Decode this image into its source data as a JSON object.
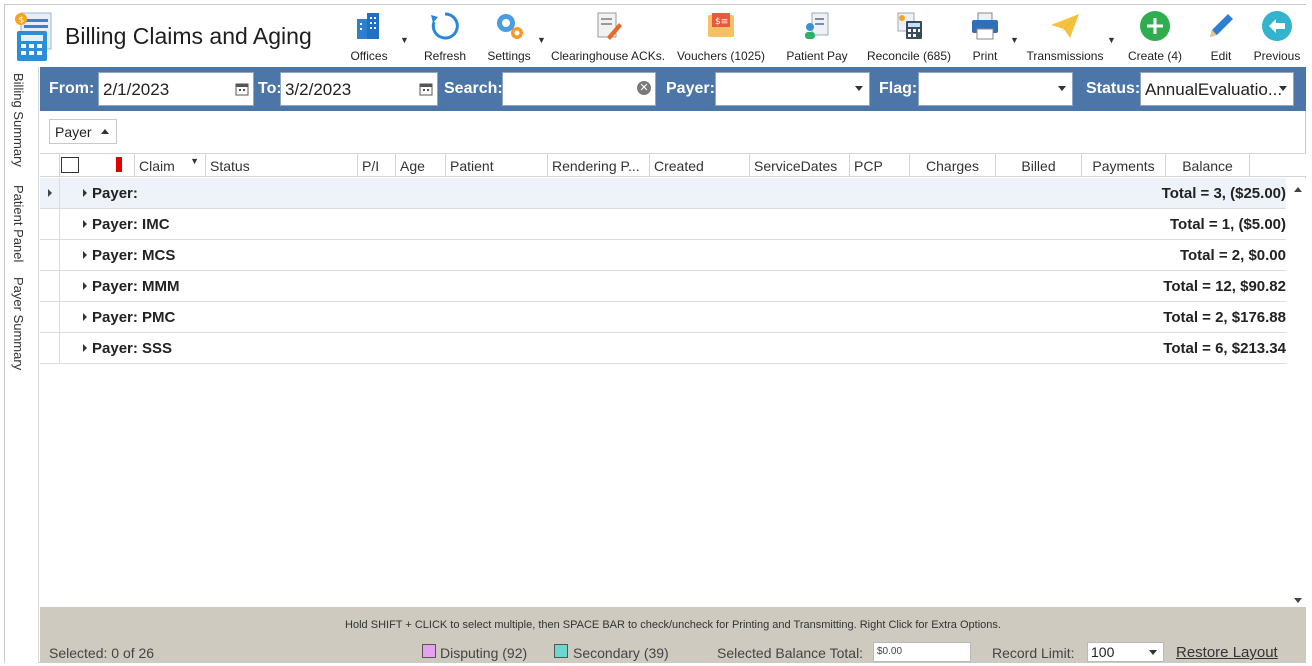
{
  "app": {
    "title": "Billing Claims and Aging"
  },
  "toolbar": {
    "items": [
      {
        "label": "Offices",
        "icon": "buildings-icon",
        "has_dropdown": true
      },
      {
        "label": "Refresh",
        "icon": "refresh-icon",
        "has_dropdown": false
      },
      {
        "label": "Settings",
        "icon": "gear-icon",
        "has_dropdown": true
      },
      {
        "label": "Clearinghouse ACKs.",
        "icon": "document-edit-icon",
        "has_dropdown": false
      },
      {
        "label": "Vouchers (1025)",
        "icon": "voucher-envelope-icon",
        "has_dropdown": false
      },
      {
        "label": "Patient Pay",
        "icon": "patient-receipt-icon",
        "has_dropdown": false
      },
      {
        "label": "Reconcile (685)",
        "icon": "calculator-icon",
        "has_dropdown": false
      },
      {
        "label": "Print",
        "icon": "printer-icon",
        "has_dropdown": true
      },
      {
        "label": "Transmissions",
        "icon": "paper-plane-icon",
        "has_dropdown": true
      },
      {
        "label": "Create (4)",
        "icon": "plus-circle-icon",
        "has_dropdown": false
      },
      {
        "label": "Edit",
        "icon": "pencil-icon",
        "has_dropdown": false
      },
      {
        "label": "Previous",
        "icon": "arrow-left-circle-icon",
        "has_dropdown": false
      }
    ]
  },
  "rail": {
    "tabs": [
      "Billing Summary",
      "Patient Panel",
      "Payer Summary"
    ]
  },
  "filters": {
    "from_label": "From:",
    "from_value": "2/1/2023",
    "to_label": "To:",
    "to_value": "3/2/2023",
    "search_label": "Search:",
    "search_value": "",
    "payer_label": "Payer:",
    "payer_value": "",
    "flag_label": "Flag:",
    "flag_value": "",
    "status_label": "Status:",
    "status_value": "AnnualEvaluatio..."
  },
  "group_by": {
    "label": "Payer"
  },
  "grid": {
    "columns": [
      "Claim",
      "Status",
      "P/I",
      "Age",
      "Patient",
      "Rendering P...",
      "Created",
      "ServiceDates",
      "PCP",
      "Charges",
      "Billed",
      "Payments",
      "Balance"
    ],
    "groups": [
      {
        "label": "Payer:",
        "total": "Total = 3,  ($25.00)"
      },
      {
        "label": "Payer: IMC",
        "total": "Total = 1,  ($5.00)"
      },
      {
        "label": "Payer: MCS",
        "total": "Total = 2,  $0.00"
      },
      {
        "label": "Payer: MMM",
        "total": "Total = 12,  $90.82"
      },
      {
        "label": "Payer: PMC",
        "total": "Total = 2,  $176.88"
      },
      {
        "label": "Payer: SSS",
        "total": "Total = 6,  $213.34"
      }
    ]
  },
  "footer": {
    "hint": "Hold SHIFT + CLICK to select multiple, then SPACE BAR to check/uncheck for Printing and Transmitting. Right Click for Extra Options.",
    "selected": "Selected: 0 of 26",
    "disputing": "Disputing (92)",
    "secondary": "Secondary (39)",
    "selected_balance_label": "Selected Balance Total:",
    "selected_balance_value": "$0.00",
    "record_limit_label": "Record Limit:",
    "record_limit_value": "100",
    "restore_layout": "Restore Layout"
  },
  "colors": {
    "filter_bar": "#4c75a8",
    "footer": "#cfcac0",
    "disputing": "#e5a3ef",
    "secondary": "#6fd6cf",
    "flag_red": "#e00000"
  }
}
